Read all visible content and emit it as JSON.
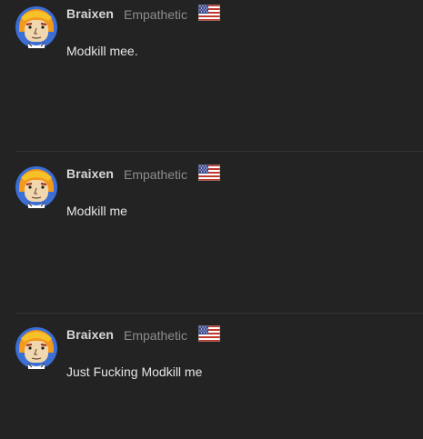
{
  "colors": {
    "background": "#232323",
    "username": "#d8d8d8",
    "rank": "#8d8d8d",
    "message": "#e6e6e6",
    "divider": "#343434"
  },
  "posts": [
    {
      "username": "Braixen",
      "rank": "Empathetic",
      "flag_icon": "us-flag-icon",
      "avatar_icon": "cartoon-face-avatar",
      "message": "Modkill mee."
    },
    {
      "username": "Braixen",
      "rank": "Empathetic",
      "flag_icon": "us-flag-icon",
      "avatar_icon": "cartoon-face-avatar",
      "message": "Modkill me"
    },
    {
      "username": "Braixen",
      "rank": "Empathetic",
      "flag_icon": "us-flag-icon",
      "avatar_icon": "cartoon-face-avatar",
      "message": "Just Fucking Modkill me"
    }
  ]
}
